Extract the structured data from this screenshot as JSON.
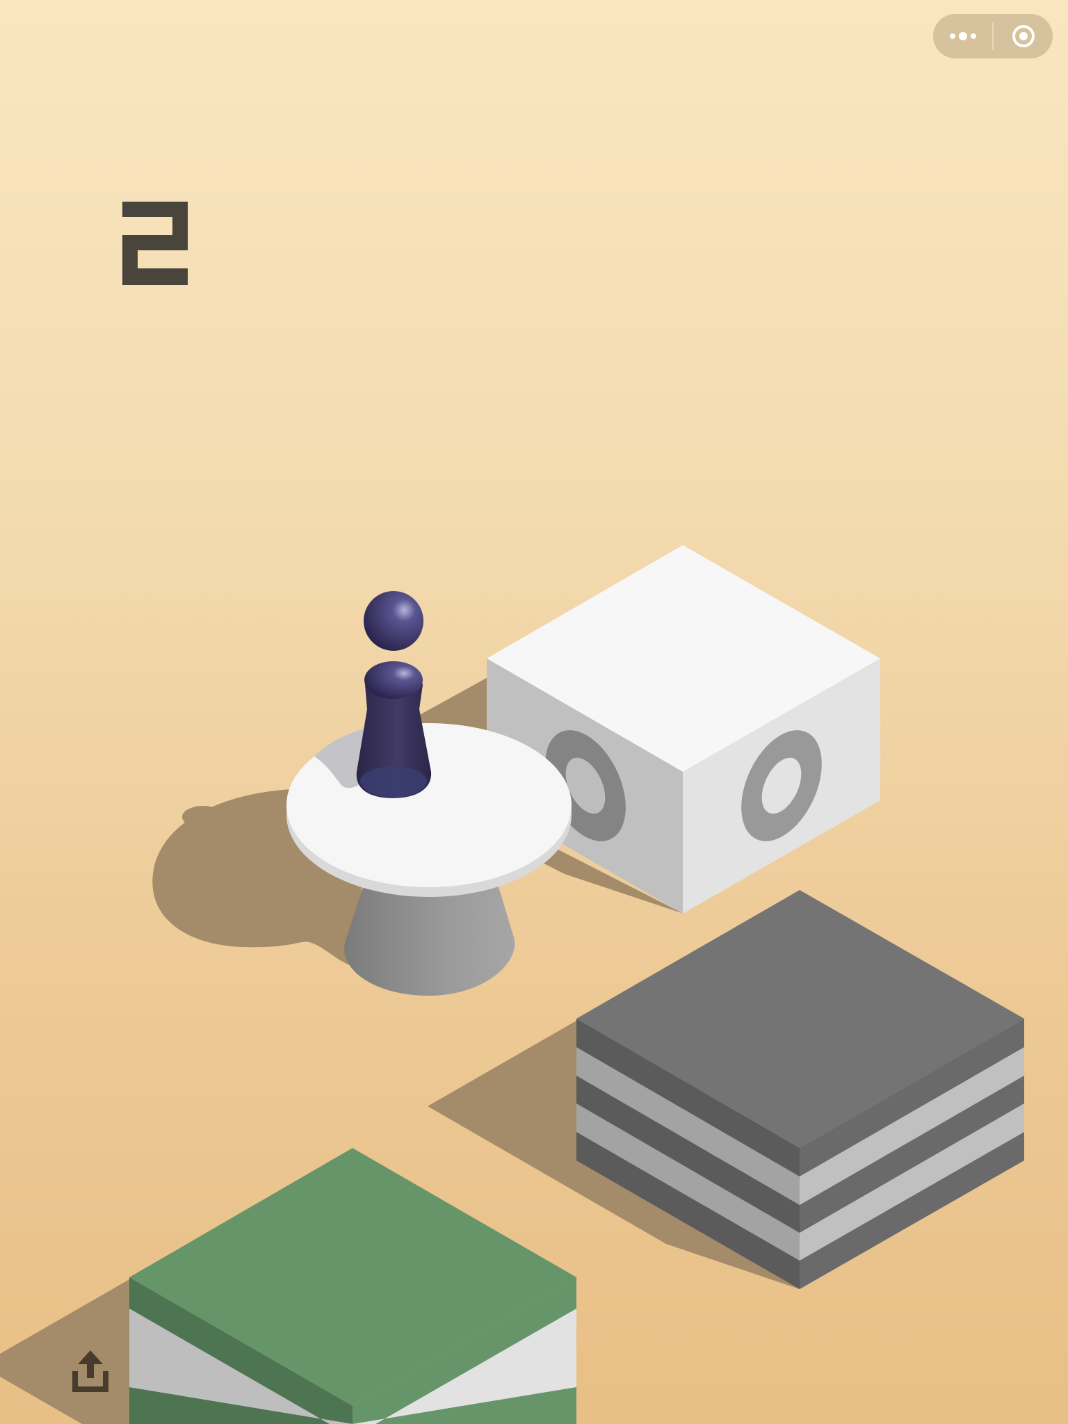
{
  "game": {
    "score": "2"
  },
  "capsule": {
    "menu_icon": "more-dots-icon",
    "close_icon": "target-circle-icon"
  },
  "toolbar": {
    "share_icon": "share-upload-icon"
  },
  "colors": {
    "background_top": "#f9e6c0",
    "background_bottom": "#e8bf86",
    "score": "#4a453c",
    "shadow": "#a48b69",
    "platform_white": "#f5f5f5",
    "block_gray": "#747474",
    "block_green": "#66956a",
    "player": "#3c3660"
  }
}
